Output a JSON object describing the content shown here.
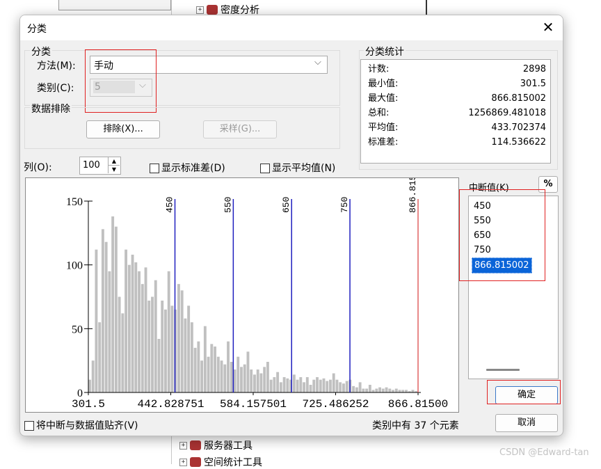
{
  "background": {
    "tree_items": [
      "密度分析",
      "服务器工具",
      "空间统计工具"
    ],
    "watermark": "CSDN @Edward-tan"
  },
  "dialog": {
    "title": "分类",
    "classify_group": {
      "label": "分类",
      "method_label": "方法(M):",
      "method_value": "手动",
      "classes_label": "类别(C):",
      "classes_value": "5"
    },
    "exclusion_group": {
      "label": "数据排除",
      "exclude_button": "排除(X)...",
      "sample_button": "采样(G)..."
    },
    "stats": {
      "label": "分类统计",
      "rows": [
        {
          "name": "计数:",
          "value": "2898"
        },
        {
          "name": "最小值:",
          "value": "301.5"
        },
        {
          "name": "最大值:",
          "value": "866.815002"
        },
        {
          "name": "总和:",
          "value": "1256869.481018"
        },
        {
          "name": "平均值:",
          "value": "433.702374"
        },
        {
          "name": "标准差:",
          "value": "114.536622"
        }
      ]
    },
    "columns_label": "列(O):",
    "columns_value": "100",
    "show_std_label": "显示标准差(D)",
    "show_mean_label": "显示平均值(N)",
    "breaks_label": "中断值(K)",
    "percent_button": "%",
    "breaks": [
      "450",
      "550",
      "650",
      "750",
      "866.815002"
    ],
    "selected_break": "866.815002",
    "ok_button": "确定",
    "cancel_button": "取消",
    "snap_label": "将中断与数据值贴齐(V)",
    "footer_prefix": "类别中有",
    "footer_count": "37",
    "footer_suffix": "个元素"
  },
  "chart_data": {
    "type": "bar",
    "xlim": [
      301.5,
      866.815002
    ],
    "ylim": [
      0,
      150
    ],
    "yticks": [
      "0",
      "50",
      "100",
      "150"
    ],
    "xticks": [
      "301.5",
      "442.828751",
      "584.157501",
      "725.486252",
      "866.81500"
    ],
    "break_lines": [
      "450",
      "550",
      "650",
      "750",
      "866.815002"
    ],
    "break_colors": [
      "#1f1fbf",
      "#1f1fbf",
      "#1f1fbf",
      "#1f1fbf",
      "#e06060"
    ],
    "bar_color": "#c0c0c0",
    "values": [
      10,
      25,
      112,
      55,
      128,
      118,
      95,
      138,
      130,
      75,
      62,
      112,
      100,
      108,
      102,
      95,
      85,
      98,
      72,
      75,
      88,
      42,
      72,
      65,
      95,
      68,
      65,
      85,
      80,
      58,
      68,
      55,
      35,
      40,
      25,
      52,
      28,
      38,
      36,
      28,
      25,
      22,
      40,
      24,
      18,
      28,
      20,
      22,
      32,
      18,
      14,
      18,
      15,
      20,
      24,
      10,
      12,
      16,
      8,
      12,
      11,
      10,
      14,
      10,
      12,
      8,
      12,
      6,
      10,
      12,
      10,
      11,
      9,
      10,
      15,
      10,
      8,
      7,
      9,
      10,
      5,
      4,
      8,
      3,
      3,
      6,
      2,
      3,
      4,
      3,
      4,
      3,
      2,
      3,
      2,
      2,
      2,
      1,
      2,
      1
    ]
  }
}
